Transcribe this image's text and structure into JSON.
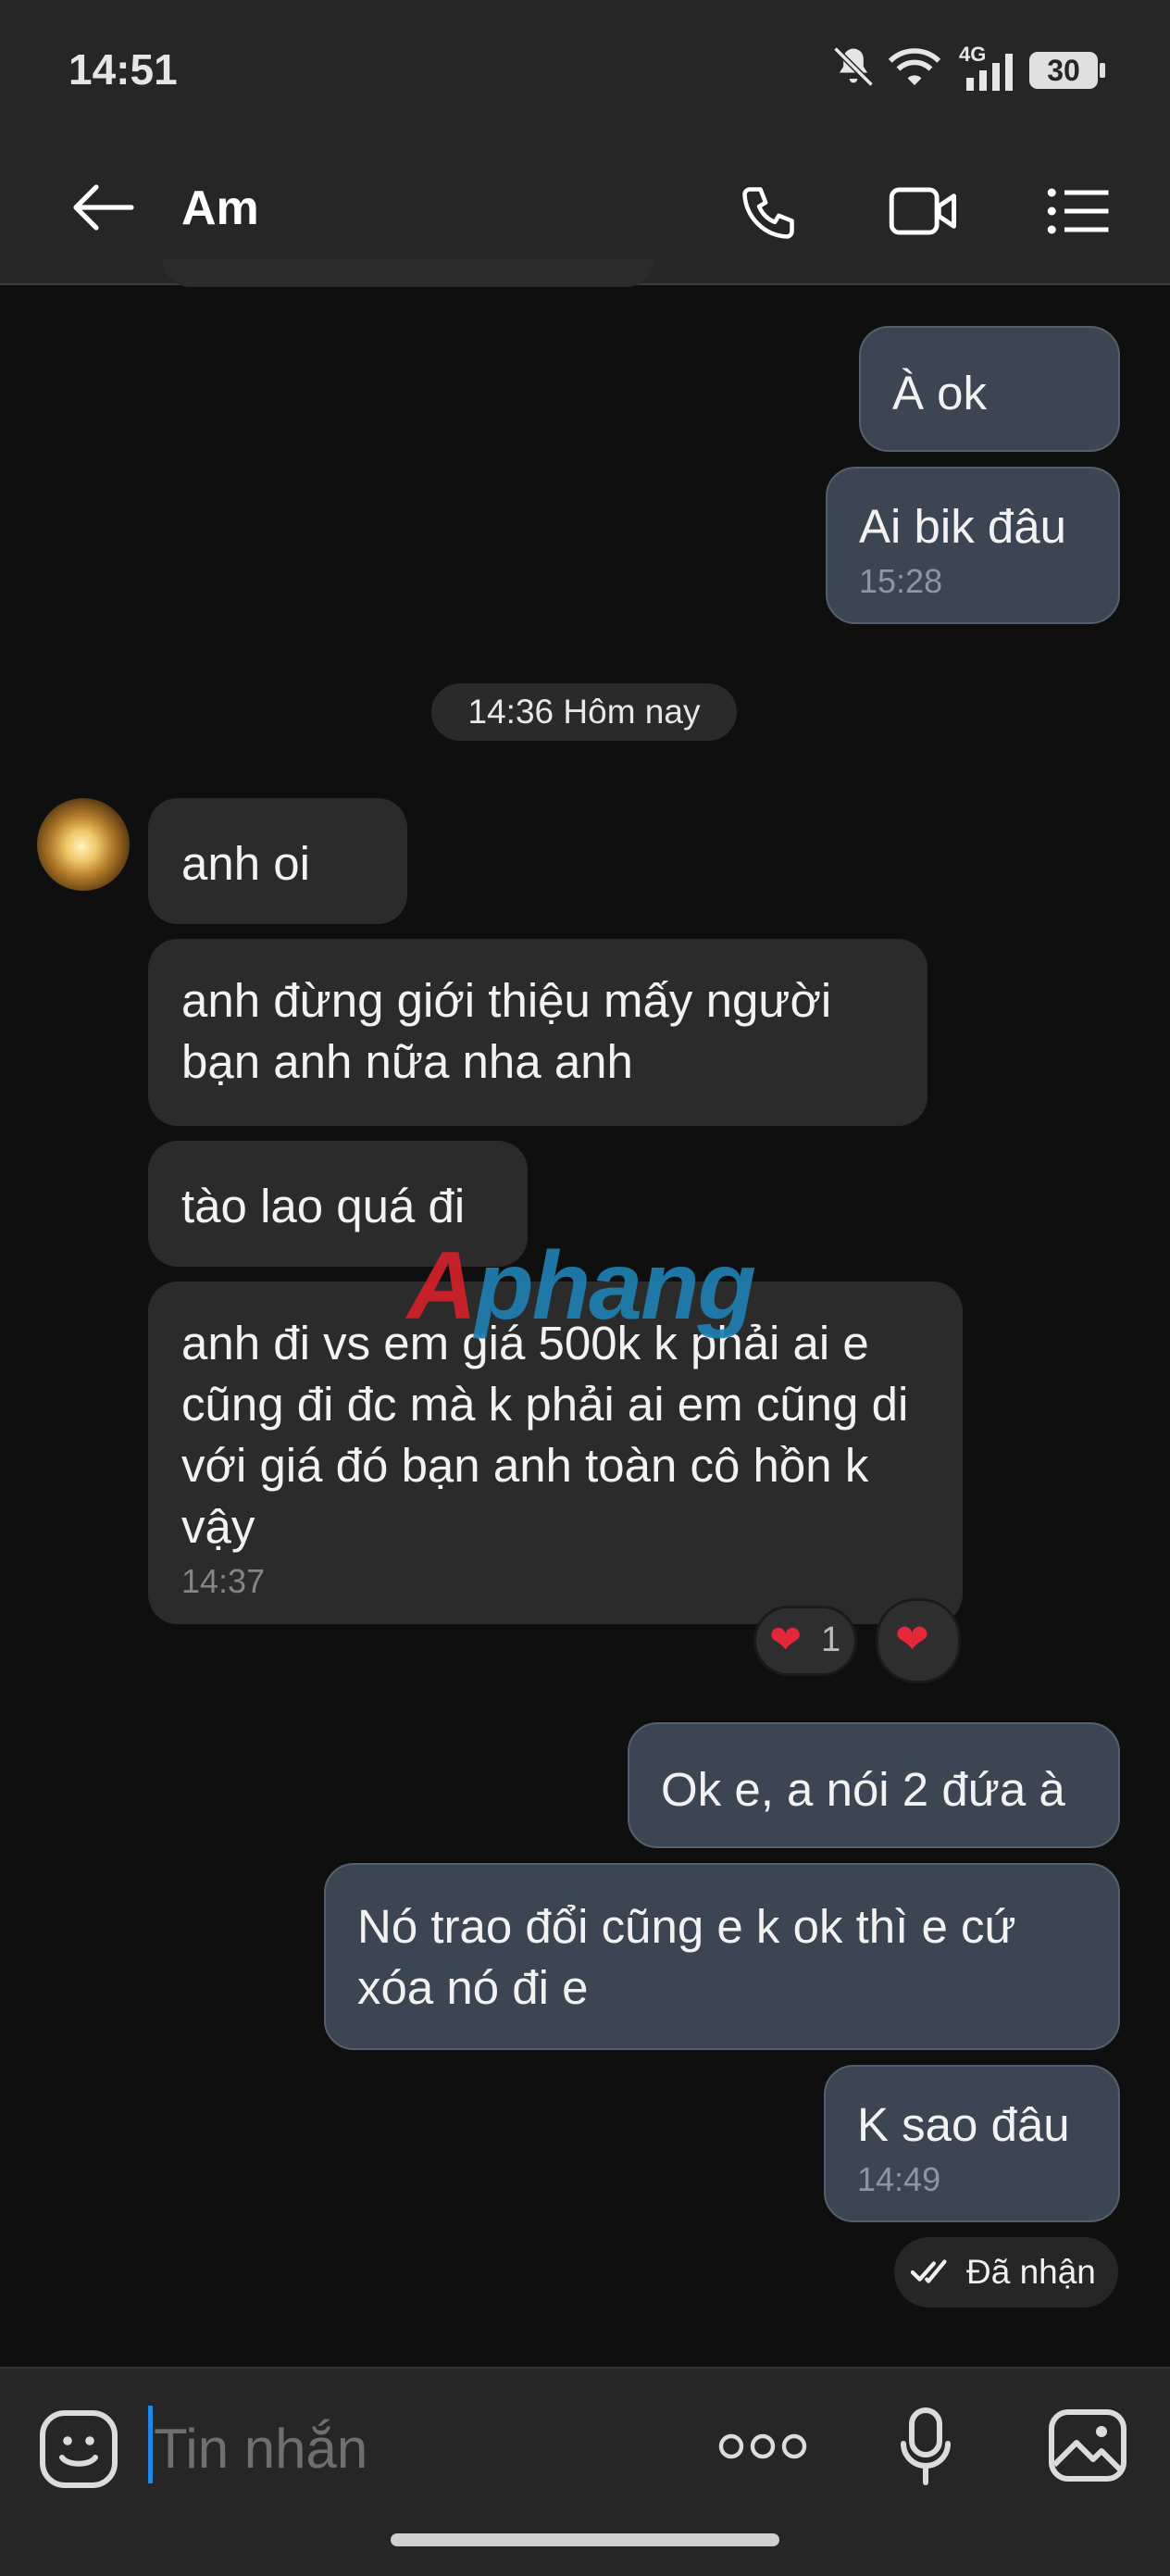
{
  "status_bar": {
    "time": "14:51",
    "battery": "30"
  },
  "header": {
    "contact_name": "Am"
  },
  "messages": [
    {
      "side": "sent",
      "text": "À ok",
      "time": ""
    },
    {
      "side": "sent",
      "text": "Ai bik đâu",
      "time": "15:28"
    },
    {
      "side": "recv",
      "text": "anh oi",
      "time": ""
    },
    {
      "side": "recv",
      "text": "anh đừng giới thiệu mấy người bạn anh nữa nha anh",
      "time": ""
    },
    {
      "side": "recv",
      "text": "tào lao quá đi",
      "time": ""
    },
    {
      "side": "recv",
      "text": "anh đi vs em giá 500k k phải ai e cũng đi đc mà k phải ai em cũng di với giá đó bạn anh toàn cô hồn k vậy",
      "time": "14:37"
    },
    {
      "side": "sent",
      "text": "Ok e, a nói 2 đứa à",
      "time": ""
    },
    {
      "side": "sent",
      "text": "Nó trao đổi cũng e k ok thì e cứ xóa nó đi e",
      "time": ""
    },
    {
      "side": "sent",
      "text": "K sao đâu",
      "time": "14:49"
    }
  ],
  "date_separator": "14:36 Hôm nay",
  "reaction": {
    "count": "1"
  },
  "delivered_label": "Đã nhận",
  "watermark": "Aphang",
  "input": {
    "placeholder": "Tin nhắn"
  },
  "colors": {
    "background": "#0f0f0f",
    "sent_bubble": "#3b4652",
    "received_bubble": "#2b2b2b",
    "heart": "#e3283a",
    "caret": "#1e88e5"
  }
}
